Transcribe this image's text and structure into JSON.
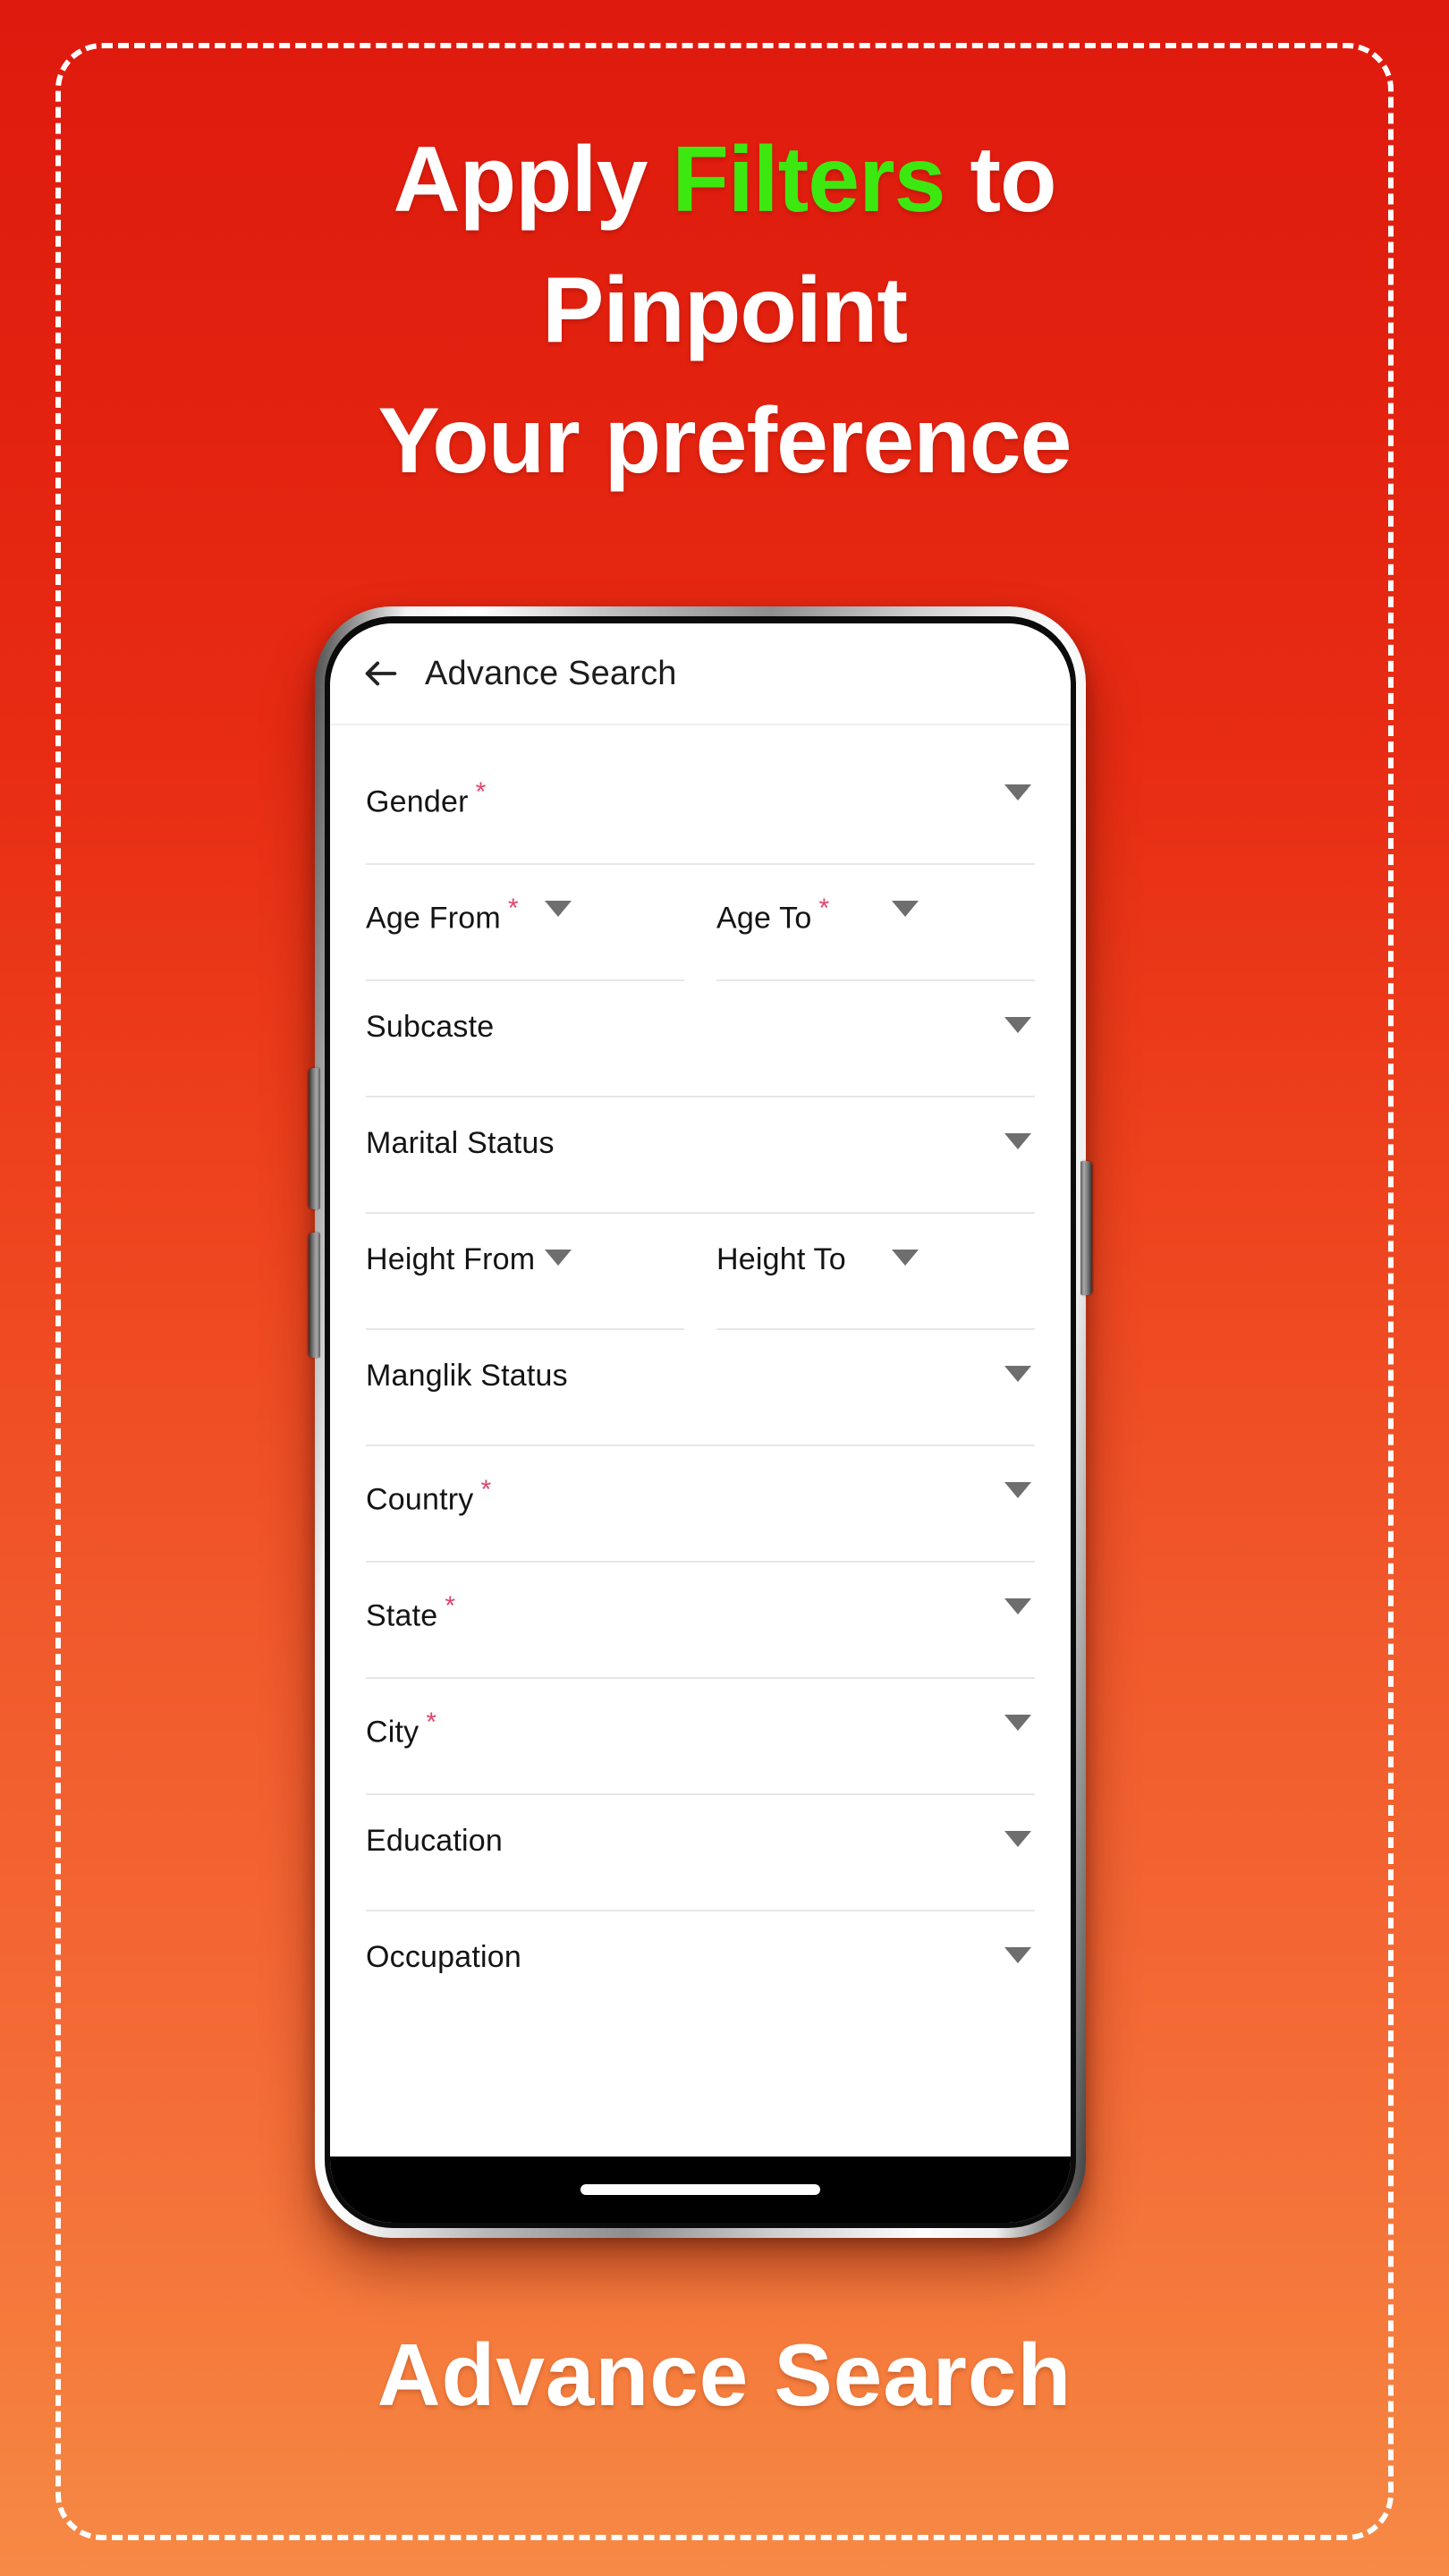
{
  "promo": {
    "headline_line1_part1": "Apply ",
    "headline_highlight": "Filters",
    "headline_line1_part2": " to",
    "headline_line2": "Pinpoint",
    "headline_line3": "Your preference",
    "caption": "Advance Search",
    "highlight_color": "#3DE810",
    "text_color": "#FFFFFF",
    "background_top_color": "#DE1A0E",
    "background_bottom_color": "#F68A46"
  },
  "phone": {
    "appbar": {
      "back_icon": "arrow-left-icon",
      "title": "Advance Search"
    },
    "required_marker": "*",
    "required_marker_color": "#E0456B",
    "dropdown_icon": "caret-down-icon",
    "form_fields": [
      {
        "label": "Gender",
        "required": true,
        "layout": "full"
      },
      {
        "label": "Age From",
        "required": true,
        "layout": "half"
      },
      {
        "label": "Age To",
        "required": true,
        "layout": "half"
      },
      {
        "label": "Subcaste",
        "required": false,
        "layout": "full"
      },
      {
        "label": "Marital Status",
        "required": false,
        "layout": "full"
      },
      {
        "label": "Height From",
        "required": false,
        "layout": "half"
      },
      {
        "label": "Height To",
        "required": false,
        "layout": "half"
      },
      {
        "label": "Manglik Status",
        "required": false,
        "layout": "full"
      },
      {
        "label": "Country",
        "required": true,
        "layout": "full"
      },
      {
        "label": "State",
        "required": true,
        "layout": "full"
      },
      {
        "label": "City",
        "required": true,
        "layout": "full"
      },
      {
        "label": "Education",
        "required": false,
        "layout": "full"
      },
      {
        "label": "Occupation",
        "required": false,
        "layout": "full"
      }
    ],
    "hardware_buttons": [
      "volume-up-button",
      "volume-down-button",
      "power-button"
    ],
    "home_indicator": "home-indicator-pill"
  }
}
